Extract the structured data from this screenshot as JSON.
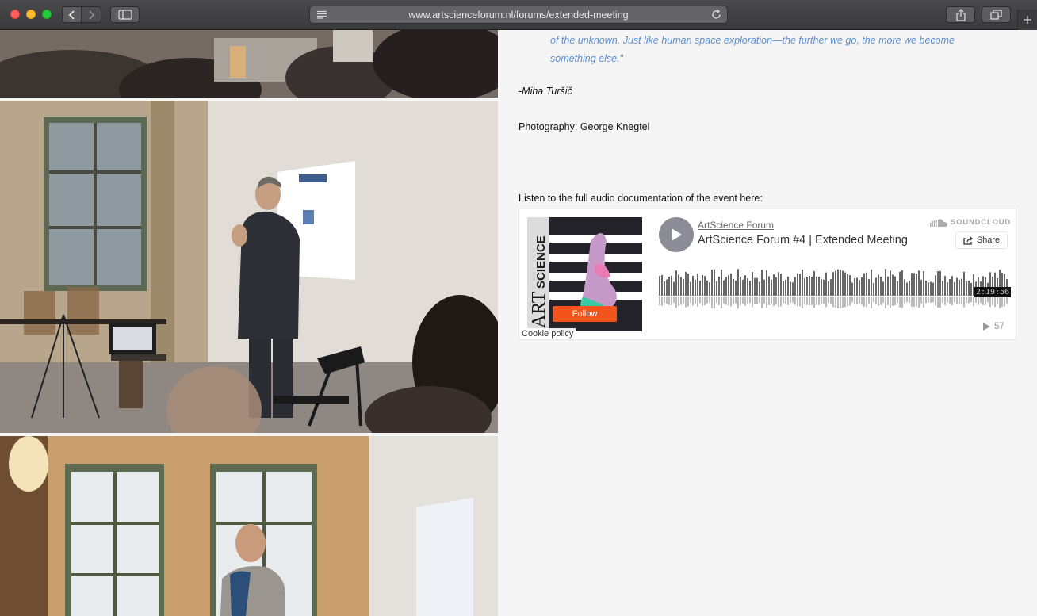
{
  "browser": {
    "url": "www.artscienceforum.nl/forums/extended-meeting"
  },
  "article": {
    "quote": "of the unknown. Just like human space exploration—the further we go, the more we become something else.\"",
    "author": "-Miha Turšič",
    "photo_credit": "Photography: George Knegtel",
    "listen_text": "Listen to the full audio documentation of the event here:"
  },
  "soundcloud": {
    "artist": "ArtScience Forum",
    "title": "ArtScience Forum #4 | Extended Meeting",
    "brand": "SOUNDCLOUD",
    "share_label": "Share",
    "follow_label": "Follow",
    "cookie_label": "Cookie policy",
    "duration": "2:19:56",
    "plays": "57"
  }
}
